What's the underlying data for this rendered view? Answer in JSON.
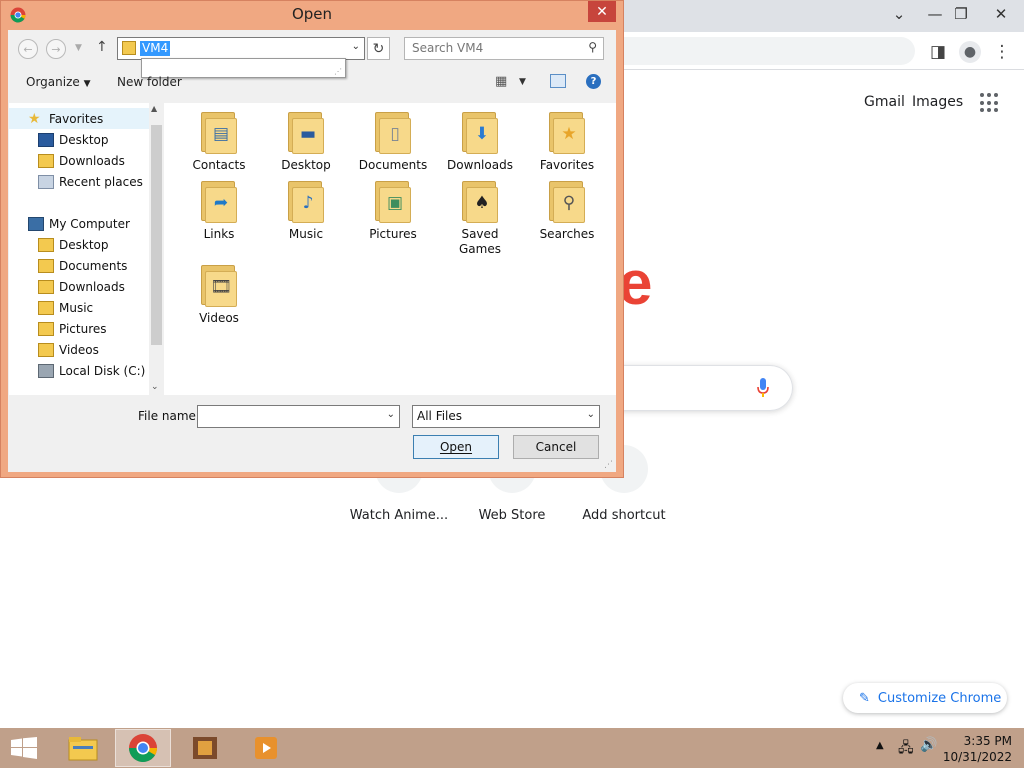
{
  "browser": {
    "toolbar_links": {
      "gmail": "Gmail",
      "images": "Images"
    },
    "shortcuts": [
      {
        "label": "Watch Anime..."
      },
      {
        "label": "Web Store"
      },
      {
        "label": "Add shortcut"
      }
    ],
    "customize_label": "Customize Chrome",
    "logo_fragment": "e"
  },
  "dialog": {
    "title": "Open",
    "address": {
      "value": "VM4"
    },
    "search_placeholder": "Search VM4",
    "toolbar": {
      "organize": "Organize",
      "new_folder": "New folder"
    },
    "nav": {
      "favorites_label": "Favorites",
      "favorites": [
        {
          "label": "Desktop",
          "icon": "desktop-icon"
        },
        {
          "label": "Downloads",
          "icon": "downloads-folder-icon"
        },
        {
          "label": "Recent places",
          "icon": "recent-places-icon"
        }
      ],
      "computer_label": "My Computer",
      "computer": [
        {
          "label": "Desktop",
          "icon": "desktop-folder-icon"
        },
        {
          "label": "Documents",
          "icon": "documents-folder-icon"
        },
        {
          "label": "Downloads",
          "icon": "downloads-folder-icon"
        },
        {
          "label": "Music",
          "icon": "music-folder-icon"
        },
        {
          "label": "Pictures",
          "icon": "pictures-folder-icon"
        },
        {
          "label": "Videos",
          "icon": "videos-folder-icon"
        },
        {
          "label": "Local Disk (C:)",
          "icon": "local-disk-icon"
        }
      ]
    },
    "items": [
      {
        "label": "Contacts",
        "icon": "contacts-folder-icon"
      },
      {
        "label": "Desktop",
        "icon": "desktop-folder-icon"
      },
      {
        "label": "Documents",
        "icon": "documents-folder-icon"
      },
      {
        "label": "Downloads",
        "icon": "downloads-folder-icon"
      },
      {
        "label": "Favorites",
        "icon": "favorites-folder-icon"
      },
      {
        "label": "Links",
        "icon": "links-folder-icon"
      },
      {
        "label": "Music",
        "icon": "music-folder-icon"
      },
      {
        "label": "Pictures",
        "icon": "pictures-folder-icon"
      },
      {
        "label": "Saved Games",
        "icon": "saved-games-folder-icon"
      },
      {
        "label": "Searches",
        "icon": "searches-folder-icon"
      },
      {
        "label": "Videos",
        "icon": "videos-folder-icon"
      }
    ],
    "file_name_label": "File name:",
    "file_name_value": "",
    "filter": "All Files",
    "open_label": "Open",
    "cancel_label": "Cancel"
  },
  "taskbar": {
    "time": "3:35 PM",
    "date": "10/31/2022"
  },
  "colors": {
    "dialog_frame": "#f0a882",
    "close_button": "#c7453c",
    "selection": "#3399ff",
    "taskbar": "#c0a08a"
  }
}
